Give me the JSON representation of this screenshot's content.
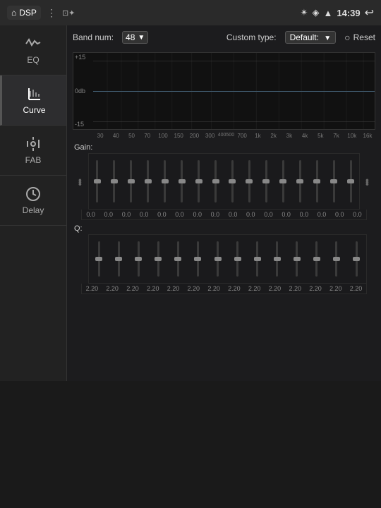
{
  "statusBar": {
    "app": "DSP",
    "icons": [
      "⊞",
      "⊡",
      "✦"
    ],
    "time": "14:39",
    "bluetooth": "⚡",
    "location": "◉",
    "wifi": "▲",
    "back": "↩"
  },
  "sidebar": {
    "items": [
      {
        "id": "eq",
        "label": "EQ",
        "icon": "eq"
      },
      {
        "id": "curve",
        "label": "Curve",
        "icon": "curve",
        "active": true
      },
      {
        "id": "fab",
        "label": "FAB",
        "icon": "fab"
      },
      {
        "id": "delay",
        "label": "Delay",
        "icon": "delay"
      }
    ]
  },
  "eq": {
    "bandNumLabel": "Band num:",
    "bandNumValue": "48",
    "customTypeLabel": "Custom type:",
    "customTypeValue": "Default:",
    "resetLabel": "Reset",
    "dbLabels": [
      "+15",
      "0db",
      "-15"
    ],
    "freqLabels": [
      "30",
      "40",
      "50",
      "70",
      "100",
      "150",
      "200",
      "300",
      "400500",
      "700",
      "1k",
      "2k",
      "3k",
      "4k",
      "5k",
      "7k",
      "10k",
      "16k"
    ],
    "gainLabel": "Gain:",
    "gainValues": [
      "0.0",
      "0.0",
      "0.0",
      "0.0",
      "0.0",
      "0.0",
      "0.0",
      "0.0",
      "0.0",
      "0.0",
      "0.0",
      "0.0",
      "0.0",
      "0.0",
      "0.0",
      "0.0"
    ],
    "qLabel": "Q:",
    "qValues": [
      "2.20",
      "2.20",
      "2.20",
      "2.20",
      "2.20",
      "2.20",
      "2.20",
      "2.20",
      "2.20",
      "2.20",
      "2.20",
      "2.20",
      "2.20",
      "2.20"
    ]
  },
  "colors": {
    "accent": "#4a7a9b",
    "bg": "#1c1c1e",
    "sidebar": "#222",
    "active": "#2d2d2f"
  }
}
